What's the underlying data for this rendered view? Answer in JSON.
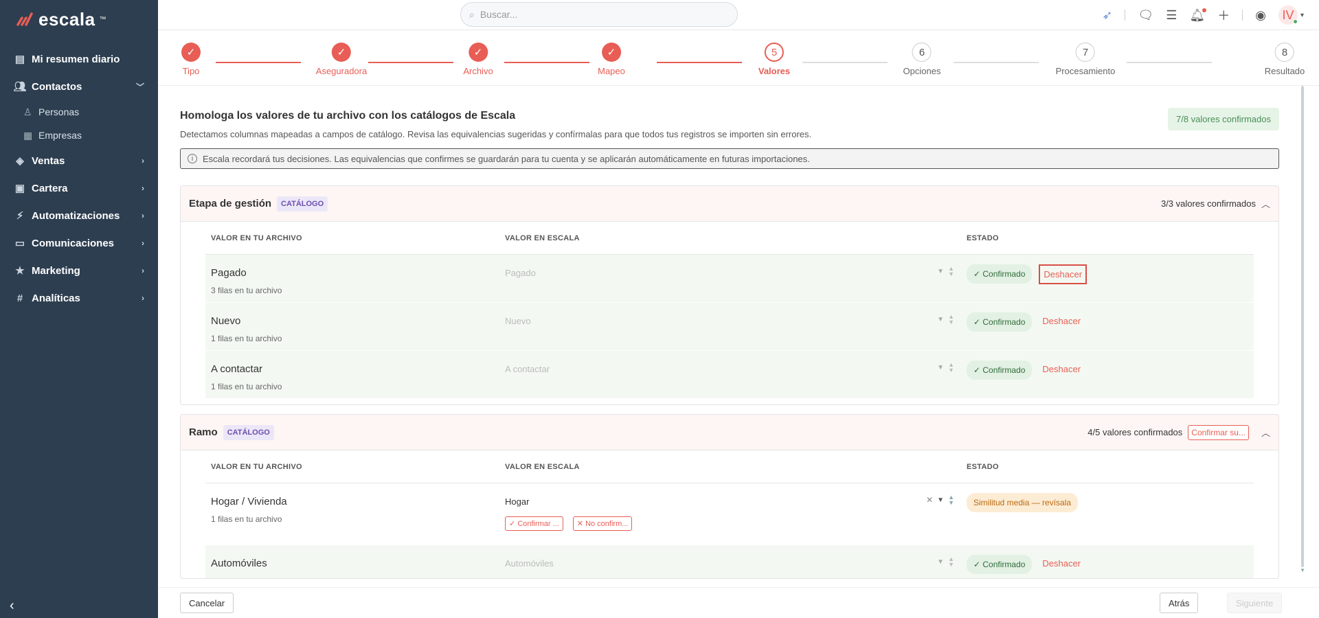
{
  "sidebar": {
    "brand": "escala",
    "items": [
      {
        "label": "Mi resumen diario",
        "icon": "chart-icon"
      },
      {
        "label": "Contactos",
        "icon": "people-icon"
      },
      {
        "label": "Ventas",
        "icon": "sales-icon"
      },
      {
        "label": "Cartera",
        "icon": "wallet-icon"
      },
      {
        "label": "Automatizaciones",
        "icon": "bolt-icon"
      },
      {
        "label": "Comunicaciones",
        "icon": "chat-icon"
      },
      {
        "label": "Marketing",
        "icon": "star-icon"
      },
      {
        "label": "Analíticas",
        "icon": "hash-icon"
      }
    ],
    "subitems": [
      {
        "label": "Personas",
        "icon": "person-icon"
      },
      {
        "label": "Empresas",
        "icon": "building-icon"
      }
    ]
  },
  "topbar": {
    "search_placeholder": "Buscar...",
    "avatar_initials": "IV"
  },
  "stepper": {
    "steps": [
      {
        "num": "✓",
        "label": "Tipo",
        "state": "done"
      },
      {
        "num": "✓",
        "label": "Aseguradora",
        "state": "done"
      },
      {
        "num": "✓",
        "label": "Archivo",
        "state": "done"
      },
      {
        "num": "✓",
        "label": "Mapeo",
        "state": "done"
      },
      {
        "num": "5",
        "label": "Valores",
        "state": "active"
      },
      {
        "num": "6",
        "label": "Opciones",
        "state": "todo"
      },
      {
        "num": "7",
        "label": "Procesamiento",
        "state": "todo"
      },
      {
        "num": "8",
        "label": "Resultado",
        "state": "todo"
      }
    ]
  },
  "page": {
    "title": "Homologa los valores de tu archivo con los catálogos de Escala",
    "description": "Detectamos columnas mapeadas a campos de catálogo. Revisa las equivalencias sugeridas y confírmalas para que todos tus registros se importen sin errores.",
    "confirmed_total": "7/8 valores confirmados",
    "info": "Escala recordará tus decisiones. Las equivalencias que confirmes se guardarán para tu cuenta y se aplicarán automáticamente en futuras importaciones."
  },
  "table_headers": {
    "file_value": "VALOR EN TU ARCHIVO",
    "escala_value": "VALOR EN ESCALA",
    "status": "ESTADO"
  },
  "sections": [
    {
      "title": "Etapa de gestión",
      "badge": "CATÁLOGO",
      "summary": "3/3 valores confirmados",
      "rows": [
        {
          "name": "Pagado",
          "count": "3 filas en tu archivo",
          "value": "Pagado",
          "status": "✓ Confirmado",
          "undo": "Deshacer"
        },
        {
          "name": "Nuevo",
          "count": "1 filas en tu archivo",
          "value": "Nuevo",
          "status": "✓ Confirmado",
          "undo": "Deshacer"
        },
        {
          "name": "A contactar",
          "count": "1 filas en tu archivo",
          "value": "A contactar",
          "status": "✓ Confirmado",
          "undo": "Deshacer"
        }
      ]
    },
    {
      "title": "Ramo",
      "badge": "CATÁLOGO",
      "summary": "4/5 valores confirmados",
      "confirm_all": "Confirmar su...",
      "rows": [
        {
          "name": "Hogar / Vivienda",
          "count": "1 filas en tu archivo",
          "value": "Hogar",
          "status": "Similitud media — revísala",
          "confirm": "✓ Confirmar ...",
          "reject": "✕ No confirm..."
        },
        {
          "name": "Automóviles",
          "count": "",
          "value": "Automóviles",
          "status": "✓ Confirmado",
          "undo": "Deshacer"
        }
      ]
    }
  ],
  "footer": {
    "cancel": "Cancelar",
    "back": "Atrás",
    "next": "Siguiente"
  }
}
